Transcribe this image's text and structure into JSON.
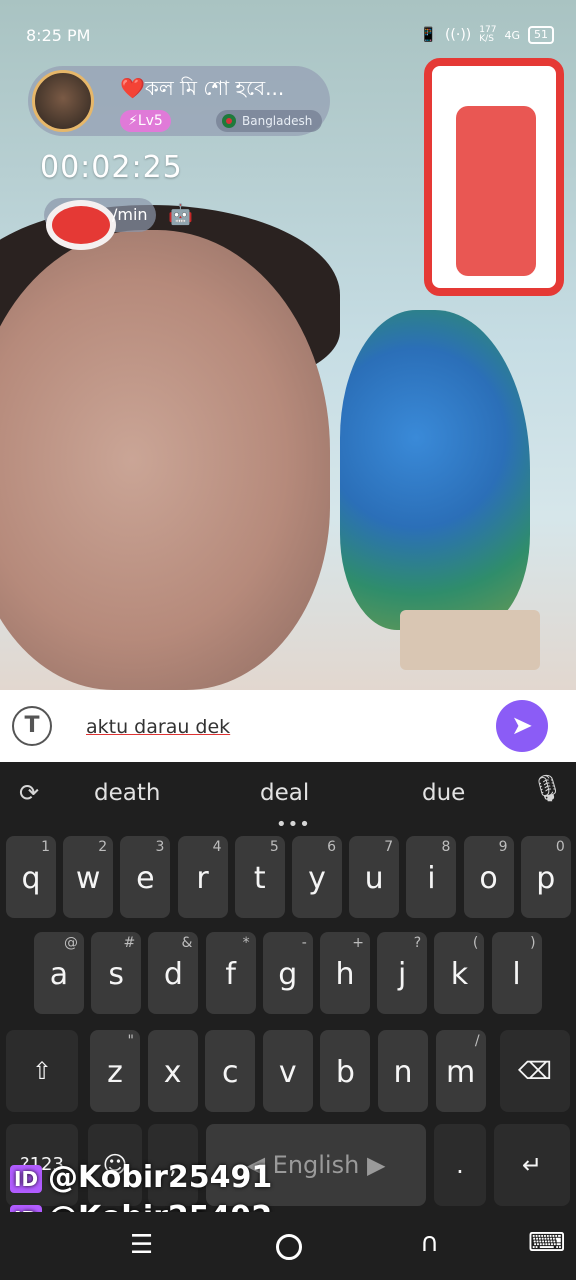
{
  "status_bar": {
    "time": "8:25 PM",
    "net_speed": "177\nK/S",
    "network": "4G",
    "battery": "51"
  },
  "profile": {
    "username": "❤️কল মি শো হবে...",
    "level": "Lv5",
    "country": "Bangladesh"
  },
  "call": {
    "timer": "00:02:25",
    "rate_suffix": "/min"
  },
  "composer": {
    "text": "aktu darau dek",
    "send_icon": "send-icon",
    "translate_icon": "translate-icon"
  },
  "keyboard": {
    "suggestions": [
      "death",
      "deal",
      "due"
    ],
    "row1": [
      {
        "k": "q",
        "s": "1"
      },
      {
        "k": "w",
        "s": "2"
      },
      {
        "k": "e",
        "s": "3"
      },
      {
        "k": "r",
        "s": "4"
      },
      {
        "k": "t",
        "s": "5"
      },
      {
        "k": "y",
        "s": "6"
      },
      {
        "k": "u",
        "s": "7"
      },
      {
        "k": "i",
        "s": "8"
      },
      {
        "k": "o",
        "s": "9"
      },
      {
        "k": "p",
        "s": "0"
      }
    ],
    "row2": [
      {
        "k": "a",
        "s": "@"
      },
      {
        "k": "s",
        "s": "#"
      },
      {
        "k": "d",
        "s": "&"
      },
      {
        "k": "f",
        "s": "*"
      },
      {
        "k": "g",
        "s": "-"
      },
      {
        "k": "h",
        "s": "+"
      },
      {
        "k": "j",
        "s": "?"
      },
      {
        "k": "k",
        "s": "("
      },
      {
        "k": "l",
        "s": ")"
      }
    ],
    "row3": [
      {
        "k": "z",
        "s": "\""
      },
      {
        "k": "x",
        "s": ""
      },
      {
        "k": "c",
        "s": ""
      },
      {
        "k": "v",
        "s": ""
      },
      {
        "k": "b",
        "s": ""
      },
      {
        "k": "n",
        "s": ""
      },
      {
        "k": "m",
        "s": "/"
      }
    ],
    "symbols_key": "?123",
    "space_label": "English",
    "period_key": ".",
    "enter_icon": "enter-icon"
  },
  "watermarks": [
    "@Kobir25491",
    "@Kobir25492"
  ],
  "watermark_tag": "ID"
}
